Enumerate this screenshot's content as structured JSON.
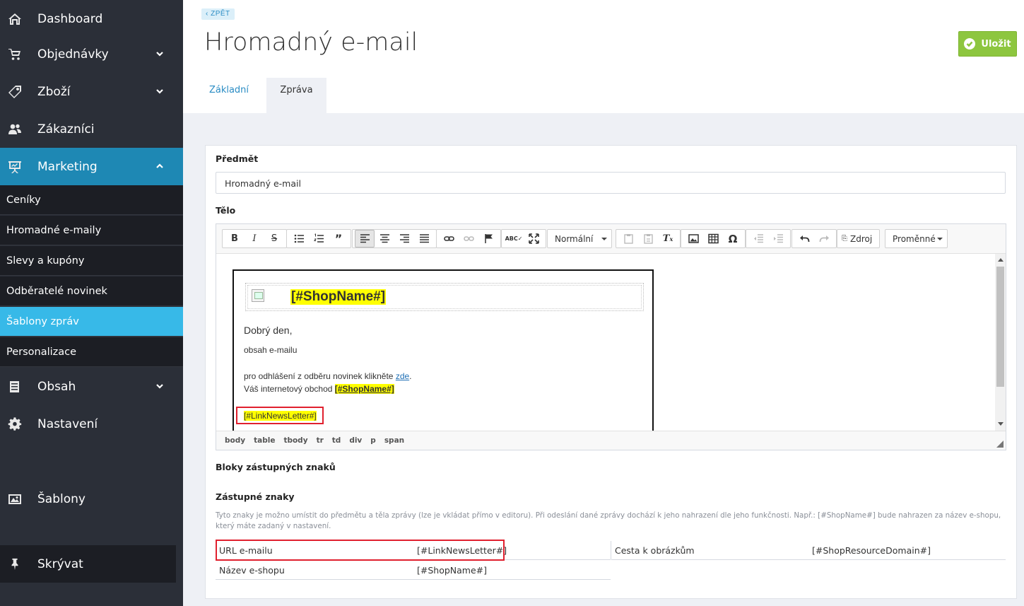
{
  "sidebar": {
    "items": [
      {
        "label": "Dashboard",
        "icon": "home-icon"
      },
      {
        "label": "Objednávky",
        "icon": "cart-icon"
      },
      {
        "label": "Zboží",
        "icon": "tag-icon"
      },
      {
        "label": "Zákazníci",
        "icon": "users-icon"
      },
      {
        "label": "Marketing",
        "icon": "presentation-icon"
      },
      {
        "label": "Obsah",
        "icon": "book-icon"
      },
      {
        "label": "Nastavení",
        "icon": "gear-icon"
      },
      {
        "label": "Šablony",
        "icon": "image-icon"
      }
    ],
    "marketing_sub": [
      "Ceníky",
      "Hromadné e-maily",
      "Slevy a kupóny",
      "Odběratelé novinek",
      "Šablony zpráv",
      "Personalizace"
    ],
    "hide_label": "Skrývat",
    "active_color": "#1e88b4",
    "active_sub_color": "#37b9e8"
  },
  "header": {
    "back_label": "ZPĚT",
    "title": "Hromadný e-mail",
    "save_label": "Uložit",
    "tabs": [
      "Základní",
      "Zpráva"
    ],
    "active_tab": "Zpráva"
  },
  "form": {
    "subject_label": "Předmět",
    "subject_value": "Hromadný e-mail",
    "body_label": "Tělo",
    "blocks_label": "Bloky zástupných znaků",
    "placeholders_label": "Zástupné znaky",
    "help_text": "Tyto znaky je možno umístit do předmětu a těla zprávy (lze je vkládat přímo v editoru). Při odeslání dané zprávy dochází k jeho nahrazení dle jeho funkčnosti. Např.: [#ShopName#] bude nahrazen za název e-shopu, který máte zadaný v nastavení."
  },
  "toolbar": {
    "format": "Normální",
    "source": "Zdroj",
    "variables": "Proměnné"
  },
  "editor_content": {
    "shop_tag": "[#ShopName#]",
    "greeting": "Dobrý den,",
    "body": "obsah e-mailu",
    "unsubscribe_prefix": "pro odhlášení z odběru novinek klikněte ",
    "unsubscribe_link": "zde",
    "unsubscribe_suffix": ".",
    "shop_line_prefix": "Váš internetový obchod ",
    "shop_line_tag": "[#ShopName#]",
    "newsletter_tag": "[#LinkNewsLetter#]"
  },
  "path_bar": [
    "body",
    "table",
    "tbody",
    "tr",
    "td",
    "div",
    "p",
    "span"
  ],
  "placeholders": [
    {
      "name": "URL e-mailu",
      "code": "[#LinkNewsLetter#]"
    },
    {
      "name": "Název e-shopu",
      "code": "[#ShopName#]"
    },
    {
      "name": "Cesta k obrázkům",
      "code": "[#ShopResourceDomain#]"
    }
  ]
}
